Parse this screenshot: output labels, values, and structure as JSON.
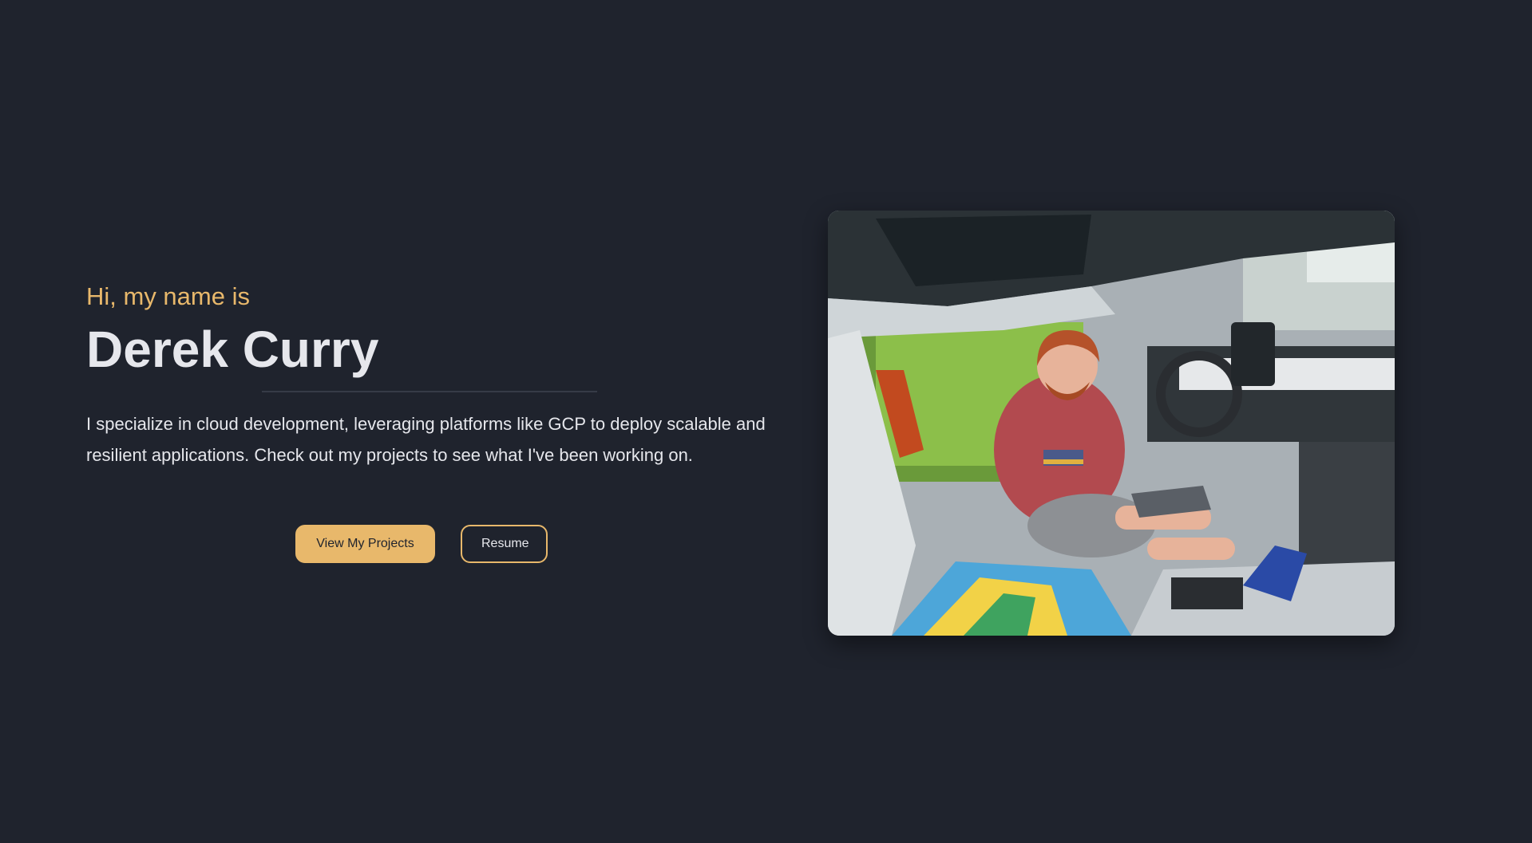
{
  "hero": {
    "greeting": "Hi, my name is",
    "name": "Derek Curry",
    "bio": "I specialize in cloud development, leveraging platforms like GCP to deploy scalable and resilient applications. Check out my projects to see what I've been working on."
  },
  "buttons": {
    "projects_label": "View My Projects",
    "resume_label": "Resume"
  },
  "theme": {
    "background": "#1f232d",
    "accent": "#e8b86b",
    "text": "#e6e7ec"
  }
}
